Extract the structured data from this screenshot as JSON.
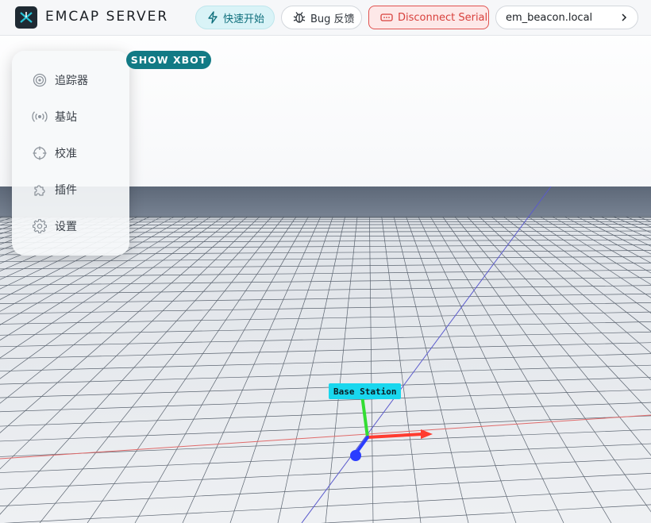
{
  "app": {
    "title": "EMCAP SERVER"
  },
  "toolbar": {
    "quick_start_label": "快速开始",
    "bug_report_label": "Bug 反馈",
    "disconnect_label": "Disconnect Serial",
    "host_label": "em_beacon.local"
  },
  "sidebar": {
    "items": [
      {
        "label": "追踪器",
        "icon": "target-icon"
      },
      {
        "label": "基站",
        "icon": "broadcast-icon"
      },
      {
        "label": "校准",
        "icon": "crosshair-icon"
      },
      {
        "label": "插件",
        "icon": "puzzle-icon"
      },
      {
        "label": "设置",
        "icon": "gear-icon"
      }
    ]
  },
  "viewport": {
    "show_xbot_label": "SHOW XBOT",
    "base_station_label": "Base Station"
  },
  "colors": {
    "accent": "#127a85",
    "danger": "#e0524f",
    "label_cyan": "#19d7ee",
    "axis_x": "#ff3b30",
    "axis_y": "#33dd33",
    "axis_z": "#2a3cff",
    "wall": "#6b7786",
    "floor": "#e8ebef"
  }
}
